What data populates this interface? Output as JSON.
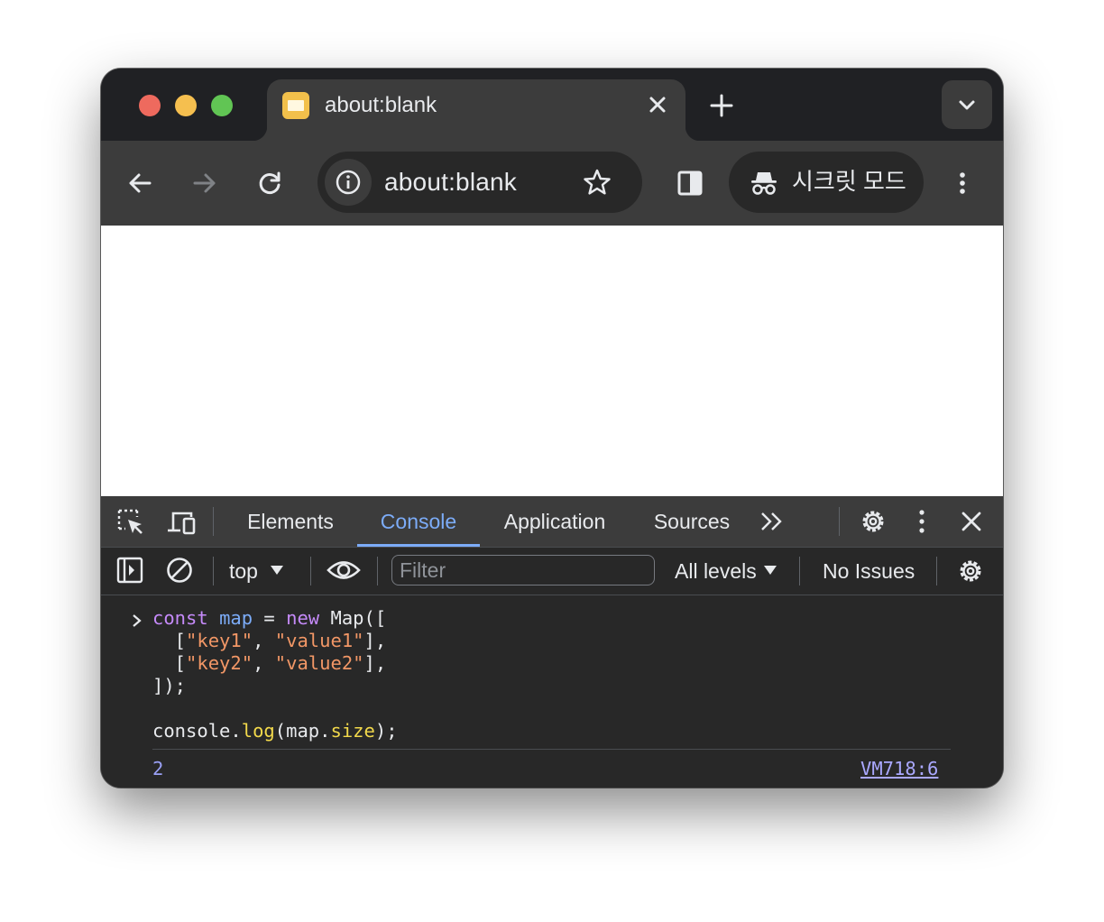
{
  "tab": {
    "title": "about:blank",
    "close": "×"
  },
  "toolbar": {
    "url": "about:blank",
    "incognito_label": "시크릿 모드"
  },
  "devtools": {
    "tabs": [
      "Elements",
      "Console",
      "Application",
      "Sources"
    ],
    "active_tab": "Console",
    "console_toolbar": {
      "context": "top",
      "filter_placeholder": "Filter",
      "levels": "All levels",
      "issues": "No Issues"
    }
  },
  "console": {
    "input_lines": [
      "const map = new Map([",
      "  [\"key1\", \"value1\"],",
      "  [\"key2\", \"value2\"],",
      "]);",
      "",
      "console.log(map.size);"
    ],
    "output_value": "2",
    "output_source": "VM718:6"
  },
  "colors": {
    "accent": "#7cacf8",
    "keyword": "#c58af9",
    "string": "#f29766",
    "function": "#f2d94b"
  },
  "icons": [
    "close-icon",
    "plus-icon",
    "chevron-down-icon",
    "back-arrow-icon",
    "forward-arrow-icon",
    "reload-icon",
    "info-icon",
    "star-icon",
    "side-panel-icon",
    "incognito-icon",
    "more-vert-icon",
    "inspect-icon",
    "device-toolbar-icon",
    "more-tabs-icon",
    "gear-icon",
    "sidebar-toggle-icon",
    "clear-console-icon",
    "eye-icon"
  ]
}
